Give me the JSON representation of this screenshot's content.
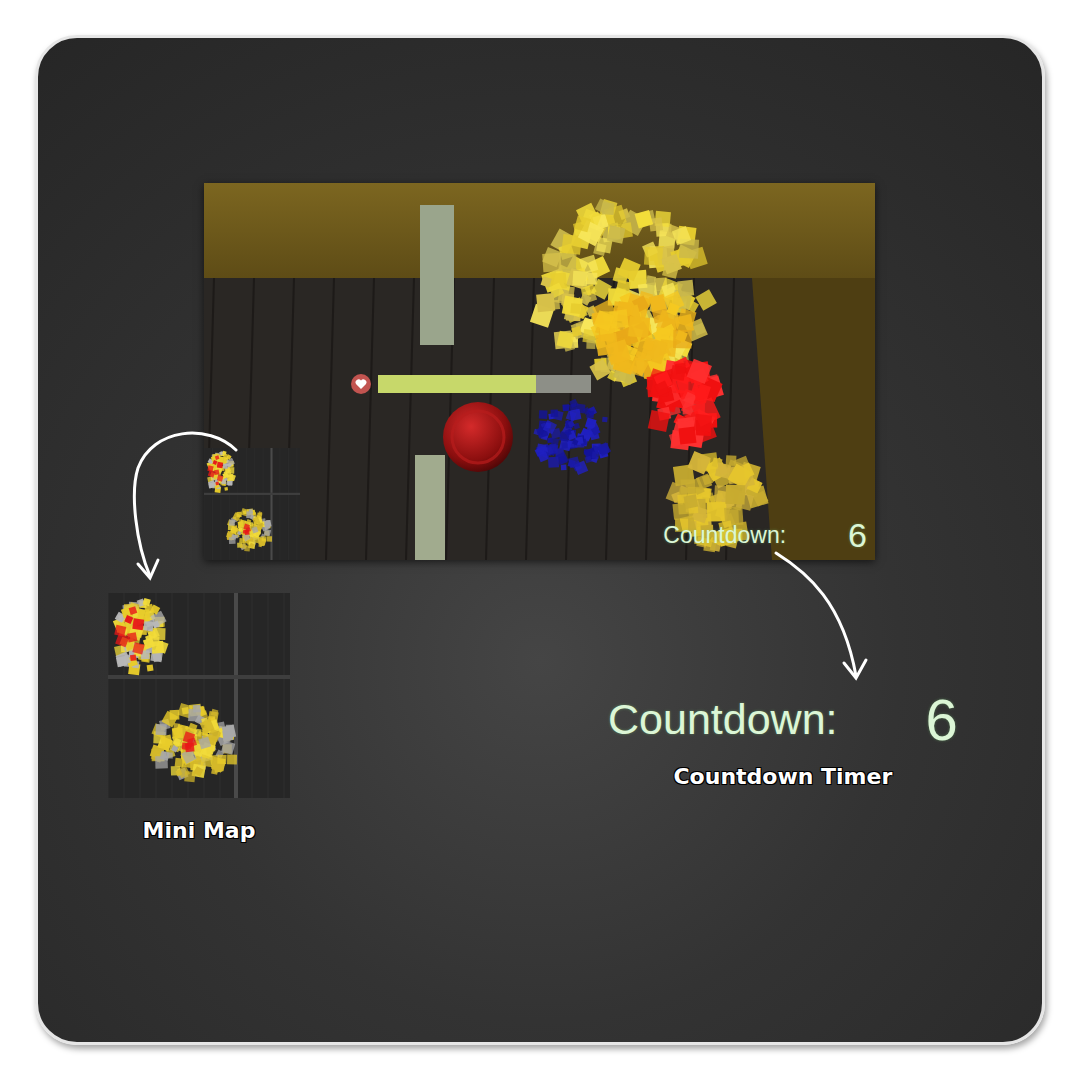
{
  "screenshot": {
    "health": {
      "level": 0.74
    },
    "countdown": {
      "label": "Countdown:",
      "value": "6"
    }
  },
  "callouts": [
    {
      "label": "Mini Map"
    },
    {
      "label": "Countdown Timer",
      "text": "Countdown:",
      "value": "6"
    }
  ]
}
